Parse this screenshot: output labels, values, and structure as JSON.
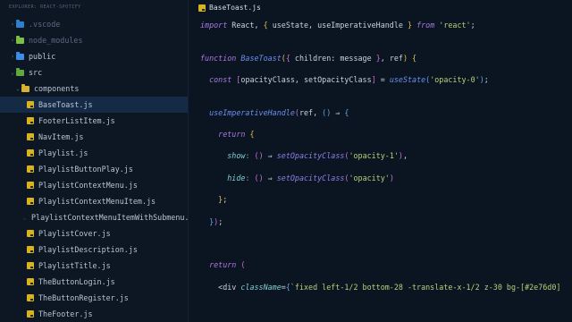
{
  "explorer": {
    "title": "EXPLORER: REACT-SPOTIFY",
    "items": [
      {
        "label": ".vscode",
        "kind": "folder",
        "variant": "vs",
        "chevron": "›",
        "dim": true
      },
      {
        "label": "node_modules",
        "kind": "folder",
        "variant": "node",
        "chevron": "›",
        "dim": true
      },
      {
        "label": "public",
        "kind": "folder",
        "variant": "",
        "chevron": "›",
        "dim": false
      },
      {
        "label": "src",
        "kind": "folder",
        "variant": "src",
        "chevron": "⌄",
        "dim": false
      },
      {
        "label": "components",
        "kind": "folder",
        "variant": "comp",
        "chevron": "⌄",
        "dim": false
      },
      {
        "label": "BaseToast.js",
        "kind": "js",
        "selected": true
      },
      {
        "label": "FooterListItem.js",
        "kind": "js"
      },
      {
        "label": "NavItem.js",
        "kind": "js"
      },
      {
        "label": "Playlist.js",
        "kind": "js"
      },
      {
        "label": "PlaylistButtonPlay.js",
        "kind": "js"
      },
      {
        "label": "PlaylistContextMenu.js",
        "kind": "js"
      },
      {
        "label": "PlaylistContextMenuItem.js",
        "kind": "js"
      },
      {
        "label": "PlaylistContextMenuItemWithSubmenu.js",
        "kind": "js"
      },
      {
        "label": "PlaylistCover.js",
        "kind": "js"
      },
      {
        "label": "PlaylistDescription.js",
        "kind": "js"
      },
      {
        "label": "PlaylistTitle.js",
        "kind": "js"
      },
      {
        "label": "TheButtonLogin.js",
        "kind": "js"
      },
      {
        "label": "TheButtonRegister.js",
        "kind": "js"
      },
      {
        "label": "TheFooter.js",
        "kind": "js"
      }
    ]
  },
  "editor": {
    "tab_label": "BaseToast.js",
    "lines": [
      [
        [
          "kw",
          "import"
        ],
        [
          "pl",
          " React, "
        ],
        [
          "br",
          "{"
        ],
        [
          "pl",
          " useState, useImperativeHandle "
        ],
        [
          "br",
          "}"
        ],
        [
          "pl",
          " "
        ],
        [
          "kw",
          "from"
        ],
        [
          "pl",
          " "
        ],
        [
          "str",
          "'react'"
        ],
        [
          "pl",
          ";"
        ]
      ],
      [],
      [],
      [
        [
          "kw",
          "function"
        ],
        [
          "pl",
          " "
        ],
        [
          "fn",
          "BaseToast"
        ],
        [
          "br",
          "("
        ],
        [
          "br2",
          "{"
        ],
        [
          "pl",
          " children: message "
        ],
        [
          "br2",
          "}"
        ],
        [
          "pl",
          ", ref"
        ],
        [
          "br",
          ")"
        ],
        [
          "pl",
          " "
        ],
        [
          "br",
          "{"
        ]
      ],
      [],
      [
        [
          "pl",
          "  "
        ],
        [
          "kw",
          "const"
        ],
        [
          "pl",
          " "
        ],
        [
          "br2",
          "["
        ],
        [
          "pl",
          "opacityClass, setOpacityClass"
        ],
        [
          "br2",
          "]"
        ],
        [
          "pl",
          " = "
        ],
        [
          "fn",
          "useState"
        ],
        [
          "br3",
          "("
        ],
        [
          "str",
          "'opacity-0'"
        ],
        [
          "br3",
          ")"
        ],
        [
          "pl",
          ";"
        ]
      ],
      [],
      [],
      [
        [
          "pl",
          "  "
        ],
        [
          "fn",
          "useImperativeHandle"
        ],
        [
          "br2",
          "("
        ],
        [
          "pl",
          "ref, "
        ],
        [
          "br3",
          "()"
        ],
        [
          "pl",
          " ⇒ "
        ],
        [
          "br3",
          "{"
        ]
      ],
      [],
      [
        [
          "pl",
          "    "
        ],
        [
          "kw",
          "return"
        ],
        [
          "pl",
          " "
        ],
        [
          "br",
          "{"
        ]
      ],
      [],
      [
        [
          "pl",
          "      "
        ],
        [
          "attr",
          "show"
        ],
        [
          "punc",
          ":"
        ],
        [
          "pl",
          " "
        ],
        [
          "br2",
          "()"
        ],
        [
          "pl",
          " ⇒ "
        ],
        [
          "fnp",
          "setOpacityClass"
        ],
        [
          "br2",
          "("
        ],
        [
          "str",
          "'opacity-1'"
        ],
        [
          "br2",
          ")"
        ],
        [
          "pl",
          ","
        ]
      ],
      [],
      [
        [
          "pl",
          "      "
        ],
        [
          "attr",
          "hide"
        ],
        [
          "punc",
          ":"
        ],
        [
          "pl",
          " "
        ],
        [
          "br2",
          "()"
        ],
        [
          "pl",
          " ⇒ "
        ],
        [
          "fnp",
          "setOpacityClass"
        ],
        [
          "br2",
          "("
        ],
        [
          "str",
          "'opacity'"
        ],
        [
          "br2",
          ")"
        ]
      ],
      [],
      [
        [
          "pl",
          "    "
        ],
        [
          "br",
          "}"
        ],
        [
          "pl",
          ";"
        ]
      ],
      [],
      [
        [
          "pl",
          "  "
        ],
        [
          "br3",
          "}"
        ],
        [
          "br2",
          ")"
        ],
        [
          "pl",
          ";"
        ]
      ],
      [],
      [],
      [],
      [
        [
          "pl",
          "  "
        ],
        [
          "kw",
          "return"
        ],
        [
          "pl",
          " "
        ],
        [
          "br2",
          "("
        ]
      ],
      [],
      [
        [
          "pl",
          "    <div "
        ],
        [
          "attr",
          "className"
        ],
        [
          "pl",
          "="
        ],
        [
          "br3",
          "{"
        ],
        [
          "str",
          "`fixed left-1/2 bottom-28 -translate-x-1/2 z-30 bg-[#2e76d0]"
        ]
      ]
    ]
  },
  "colors": {
    "background": "#0b1421",
    "sidebar": "#0d1724",
    "selection": "#152b45",
    "keyword": "#a77ae0",
    "function": "#6b8ff0",
    "string": "#b8d07a",
    "bracket": "#e2c24e"
  }
}
